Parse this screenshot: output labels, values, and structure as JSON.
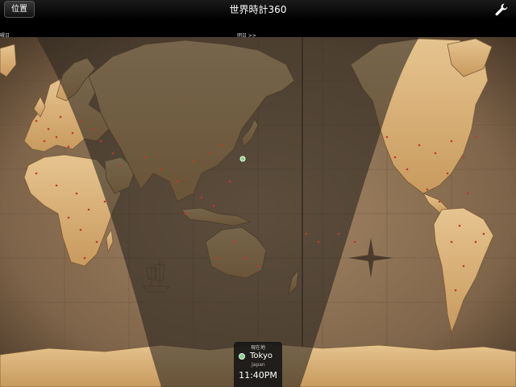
{
  "navbar": {
    "location_button": "位置",
    "title": "世界時計360",
    "settings_icon": "wrench-icon"
  },
  "date_labels": {
    "left": "曜日",
    "tomorrow": "明日 >>"
  },
  "map": {
    "colors": {
      "ocean": "#8b7156",
      "land": "#e2c08a",
      "night_overlay": "#2c2620",
      "city_dot": "#c0392b",
      "current_marker": "#86d08e"
    }
  },
  "current_location": {
    "header": "現在地",
    "city": "Tokyo",
    "country": "Japan",
    "time": "11:40PM"
  }
}
